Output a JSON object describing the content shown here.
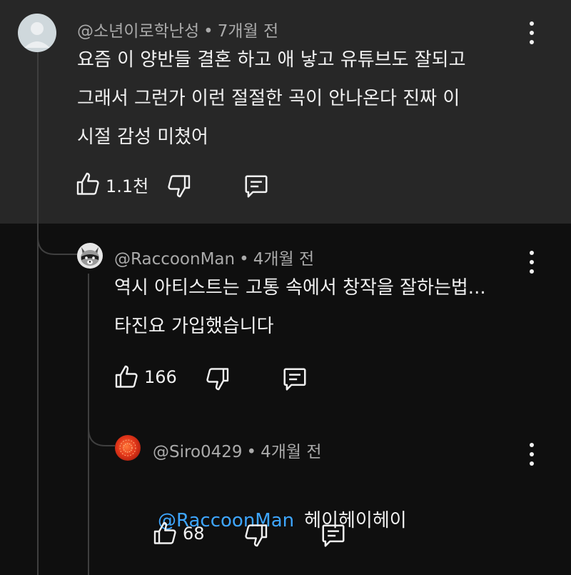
{
  "comments": [
    {
      "handle": "@소년이로학난성",
      "time": "7개월 전",
      "text": "요즘 이 양반들 결혼 하고 애 낳고 유튜브도 잘되고\n그래서 그런가 이런 절절한 곡이 안나온다 진짜 이\n시절 감성 미쳤어",
      "likes": "1.1천"
    },
    {
      "handle": "@RaccoonMan",
      "time": "4개월 전",
      "text": "역시 아티스트는 고통 속에서 창작을 잘하는법...\n타진요 가입했습니다",
      "likes": "166"
    },
    {
      "handle": "@Siro0429",
      "time": "4개월 전",
      "mention": "@RaccoonMan",
      "text": "헤이헤이헤이",
      "likes": "68"
    }
  ],
  "separator": "•",
  "icons": [
    "thumbs-up-icon",
    "thumbs-down-icon",
    "reply-icon",
    "more-vert-icon",
    "default-avatar-icon",
    "raccoon-avatar",
    "red-avatar"
  ],
  "colors": {
    "background": "#0f0f0f",
    "highlight": "#272727",
    "mention": "#3ea6ff",
    "meta": "#aaaaaa"
  }
}
